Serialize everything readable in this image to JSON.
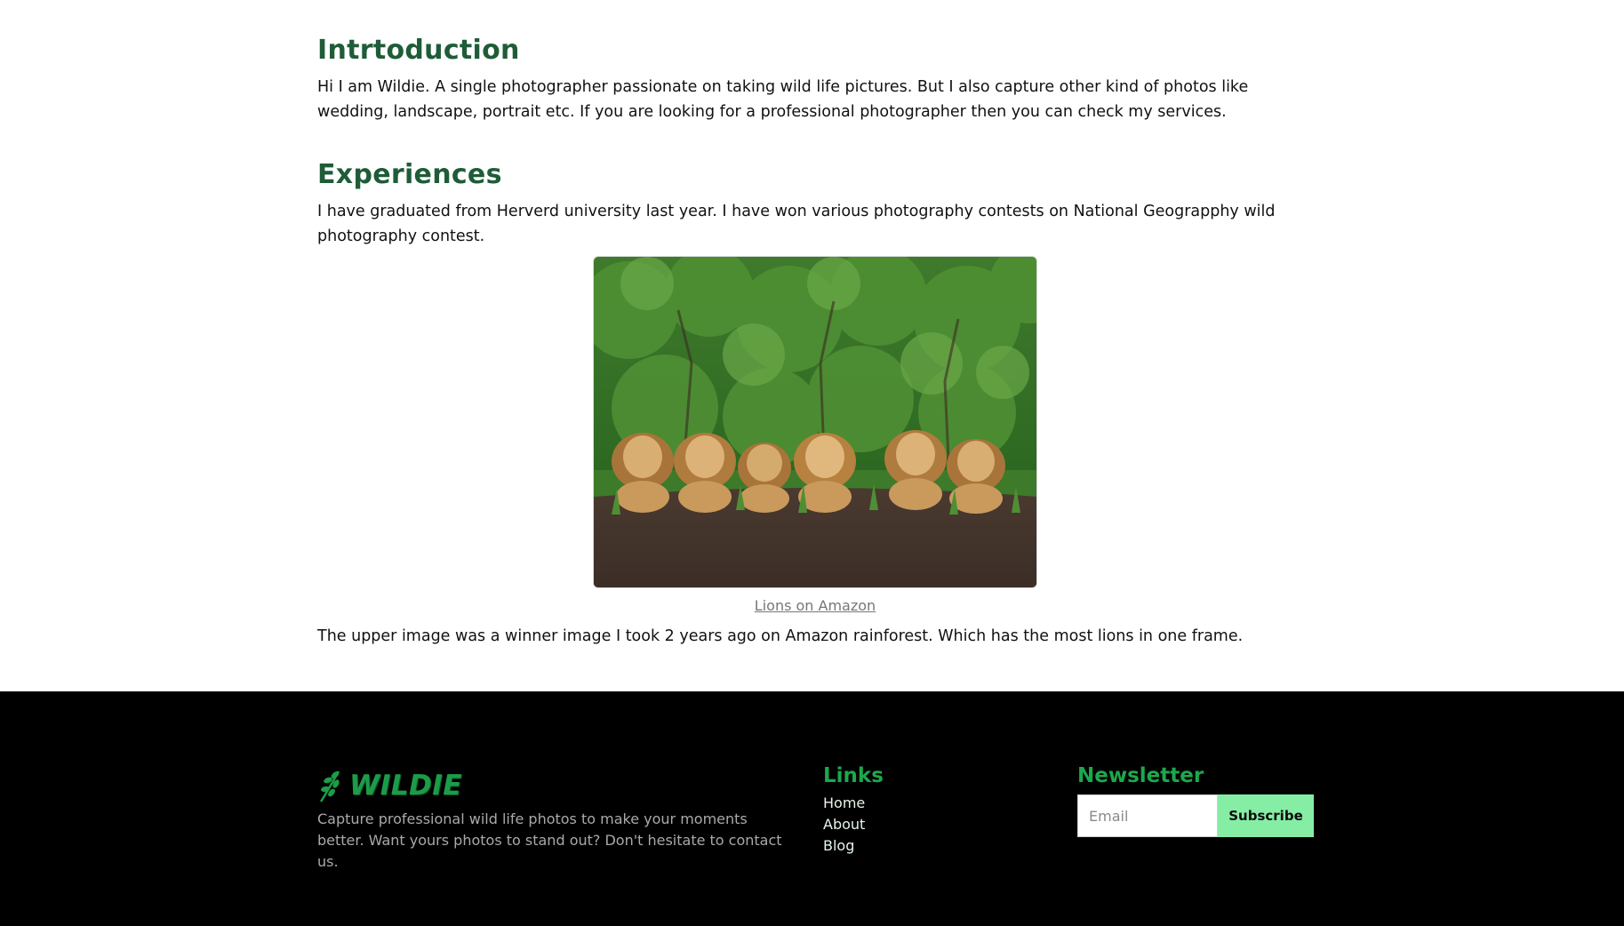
{
  "intro": {
    "title": "Intrtoduction",
    "text": "Hi I am Wildie. A single photographer passionate on taking wild life pictures. But I also capture other kind of photos like wedding, landscape, portrait etc. If you are looking for a professional photographer then you can check my services."
  },
  "experiences": {
    "title": "Experiences",
    "text": "I have graduated from Herverd university last year. I have won various photography contests on National Geograpphy wild photography contest.",
    "image_caption": "Lions on Amazon",
    "after_text": "The upper image was a winner image I took 2 years ago on Amazon rainforest. Which has the most lions in one frame."
  },
  "footer": {
    "brand": "WILDIE",
    "description": "Capture professional wild life photos to make your moments better. Want yours photos to stand out? Don't hesitate to contact us.",
    "links_title": "Links",
    "links": [
      "Home",
      "About",
      "Blog"
    ],
    "newsletter_title": "Newsletter",
    "email_placeholder": "Email",
    "subscribe_label": "Subscribe"
  },
  "colors": {
    "heading": "#1f5c38",
    "footer_bg": "#000000",
    "footer_heading": "#1ca84c",
    "subscribe_bg": "#86eea4"
  }
}
